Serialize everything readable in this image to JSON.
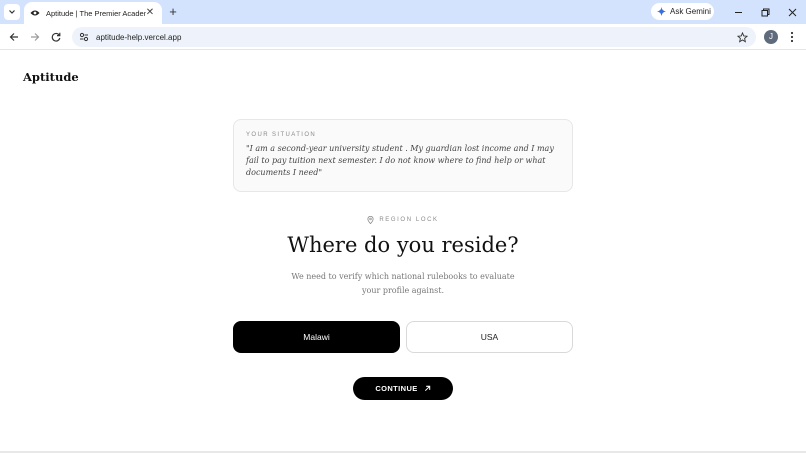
{
  "browser": {
    "tab_title": "Aptitude | The Premier Academ",
    "url": "aptitude-help.vercel.app",
    "gemini_label": "Ask Gemini",
    "profile_initial": "J"
  },
  "page": {
    "brand": "Aptitude",
    "situation": {
      "label": "YOUR SITUATION",
      "quote": "\"I am a second-year university student . My guardian lost income and I may fail to pay tuition next semester. I do not know where to find help or what documents I need\""
    },
    "region_lock_label": "REGION LOCK",
    "question": "Where do you reside?",
    "subtext": "We need to verify which national rulebooks to evaluate your profile against.",
    "options": [
      {
        "label": "Malawi",
        "selected": true
      },
      {
        "label": "USA",
        "selected": false
      }
    ],
    "continue_label": "CONTINUE"
  },
  "colors": {
    "chrome_tabbar": "#d3e3fd",
    "accent": "#000000",
    "card_bg": "#fafafa"
  }
}
